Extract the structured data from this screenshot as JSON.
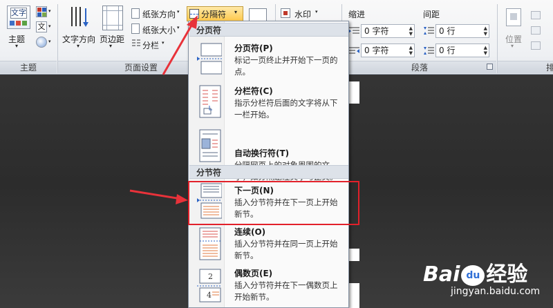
{
  "ribbon": {
    "theme_group": {
      "label": "主题",
      "button_label": "主题",
      "doc_icon_text": "文字",
      "mini_icon_text": "文"
    },
    "page_setup_group": {
      "label": "页面设置",
      "text_direction": "文字方向",
      "margins": "页边距",
      "orientation": "纸张方向",
      "size": "纸张大小",
      "columns": "分栏",
      "breaks": "分隔符"
    },
    "page_bg_group": {
      "watermark": "水印"
    },
    "paragraph_group": {
      "label": "段落",
      "indent_label": "缩进",
      "spacing_label": "间距",
      "indent_left_value": "0 字符",
      "indent_right_value": "0 字符",
      "spacing_before_value": "0 行",
      "spacing_after_value": "0 行"
    },
    "arrange_group": {
      "position": "位置",
      "label_partial": "排"
    }
  },
  "menu": {
    "page_breaks_header": "分页符",
    "section_breaks_header": "分节符",
    "items": [
      {
        "title": "分页符(P)",
        "desc": "标记一页终止并开始下一页的点。"
      },
      {
        "title": "分栏符(C)",
        "desc": "指示分栏符后面的文字将从下一栏开始。"
      },
      {
        "title": "自动换行符(T)",
        "desc": "分隔网页上的对象周围的文字，如分隔题注文字与正文。"
      },
      {
        "title": "下一页(N)",
        "desc": "插入分节符并在下一页上开始新节。"
      },
      {
        "title": "连续(O)",
        "desc": "插入分节符并在同一页上开始新节。"
      },
      {
        "title": "偶数页(E)",
        "desc": "插入分节符并在下一偶数页上开始新节。"
      }
    ],
    "even_page_icon_numbers": [
      "2",
      "4"
    ]
  },
  "watermark": {
    "brand": "Bai",
    "brand2": "经验",
    "paw": "du",
    "url": "jingyan.baidu.com"
  },
  "colors": {
    "highlight_box": "#e2202a",
    "arrow": "#e8323a",
    "ribbon_bg": "#eef0f3",
    "menu_header": "#dde2e9"
  }
}
